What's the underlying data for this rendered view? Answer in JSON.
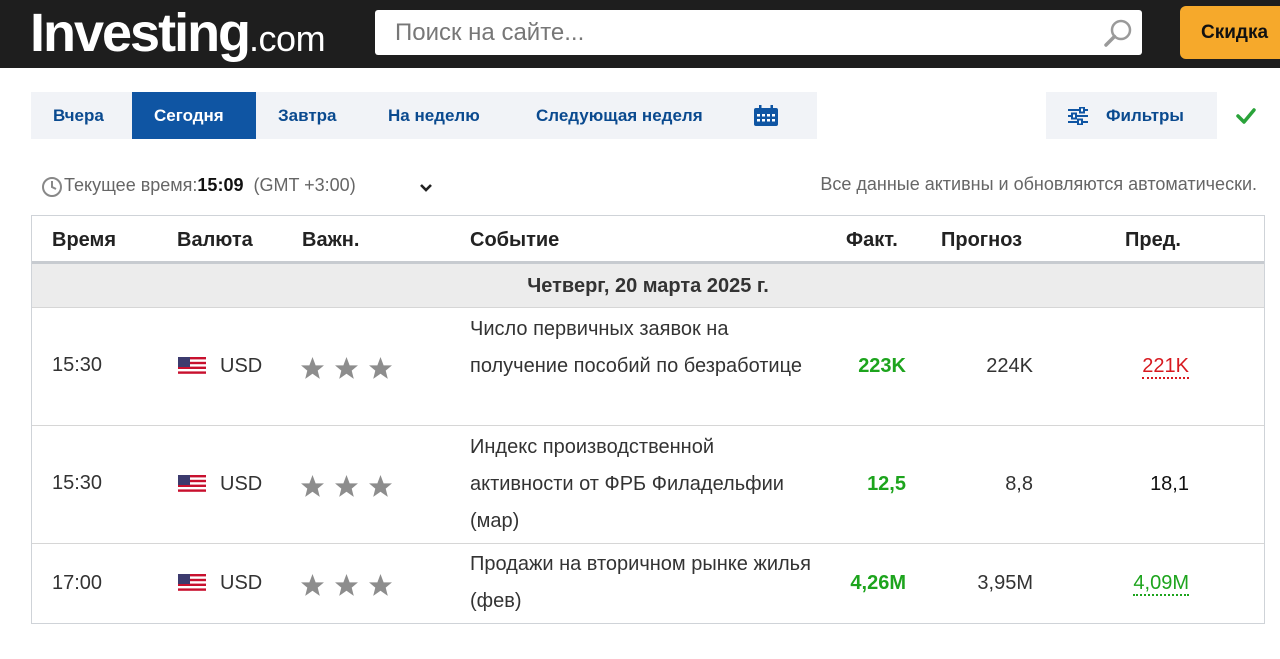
{
  "header": {
    "logo_main": "Investing",
    "logo_domain": ".com",
    "search_placeholder": "Поиск на сайте...",
    "promo_label": "Скидка",
    "search_icon": "magnifier-icon"
  },
  "tabs": [
    {
      "label": "Вчера",
      "active": false
    },
    {
      "label": "Сегодня",
      "active": true
    },
    {
      "label": "Завтра",
      "active": false
    },
    {
      "label": "На неделю",
      "active": false
    },
    {
      "label": "Следующая неделя",
      "active": false
    }
  ],
  "calendar_icon": "calendar-icon",
  "filters": {
    "label": "Фильтры",
    "icon": "sliders-icon"
  },
  "status_icon": "checkmark-icon",
  "info": {
    "time_prefix": "Текущее время:",
    "time_value": "15:09",
    "timezone": "(GMT +3:00)",
    "auto_update": "Все данные активны и обновляются автоматически."
  },
  "table": {
    "headers": {
      "time": "Время",
      "currency": "Валюта",
      "importance": "Важн.",
      "event": "Событие",
      "actual": "Факт.",
      "forecast": "Прогноз",
      "previous": "Пред."
    },
    "day_label": "Четверг, 20 марта 2025 г.",
    "rows": [
      {
        "time": "15:30",
        "currency": "USD",
        "importance_stars": 3,
        "event": "Число первичных заявок на получение пособий по безработице",
        "actual": "223K",
        "forecast": "224K",
        "previous": "221K",
        "previous_trend": "down"
      },
      {
        "time": "15:30",
        "currency": "USD",
        "importance_stars": 3,
        "event": "Индекс производственной активности от ФРБ Филадельфии (мар)",
        "actual": "12,5",
        "forecast": "8,8",
        "previous": "18,1",
        "previous_trend": "neutral"
      },
      {
        "time": "17:00",
        "currency": "USD",
        "importance_stars": 3,
        "event": "Продажи на вторичном рынке жилья (фев)",
        "actual": "4,26M",
        "forecast": "3,95M",
        "previous": "4,09M",
        "previous_trend": "up"
      }
    ]
  },
  "colors": {
    "header_bg": "#1e1e1e",
    "promo_bg": "#f6a92b",
    "tab_active_bg": "#0f55a3",
    "tab_text": "#0a4a8f",
    "positive": "#1da41d",
    "negative": "#d7191f"
  }
}
